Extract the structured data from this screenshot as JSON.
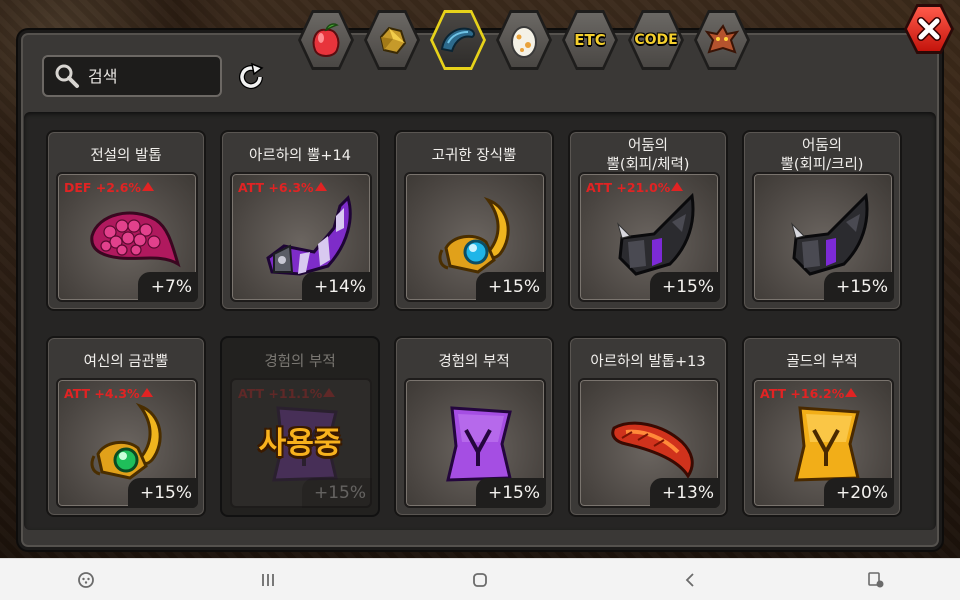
{
  "search": {
    "placeholder": "검색"
  },
  "tabs": [
    {
      "icon": "fruit-icon",
      "label": ""
    },
    {
      "icon": "gold-ore-icon",
      "label": ""
    },
    {
      "icon": "horn-icon",
      "label": "",
      "active": true
    },
    {
      "icon": "egg-icon",
      "label": ""
    },
    {
      "icon": "etc-tab",
      "label": "ETC"
    },
    {
      "icon": "code-tab",
      "label": "CODE"
    },
    {
      "icon": "dragon-icon",
      "label": ""
    }
  ],
  "items": [
    {
      "name": "전설의 발톱",
      "stat": "DEF +2.6%",
      "bonus": "+7%",
      "art": "scale-claw"
    },
    {
      "name": "아르하의 뿔+14",
      "stat": "ATT +6.3%",
      "bonus": "+14%",
      "art": "purple-horn"
    },
    {
      "name": "고귀한 장식뿔",
      "stat": "",
      "bonus": "+15%",
      "art": "gold-horn-blue"
    },
    {
      "name": "어둠의\n뿔(회피/체력)",
      "stat": "ATT +21.0%",
      "bonus": "+15%",
      "art": "dark-horn"
    },
    {
      "name": "어둠의\n뿔(회피/크리)",
      "stat": "",
      "bonus": "+15%",
      "art": "dark-horn"
    },
    {
      "name": "여신의 금관뿔",
      "stat": "ATT +4.3%",
      "bonus": "+15%",
      "art": "gold-horn-green"
    },
    {
      "name": "경험의 부적",
      "stat": "ATT +11.1%",
      "bonus": "+15%",
      "art": "purple-charm",
      "in_use": true,
      "in_use_label": "사용중"
    },
    {
      "name": "경험의 부적",
      "stat": "",
      "bonus": "+15%",
      "art": "purple-charm"
    },
    {
      "name": "아르하의 발톱+13",
      "stat": "",
      "bonus": "+13%",
      "art": "red-claw"
    },
    {
      "name": "골드의 부적",
      "stat": "ATT +16.2%",
      "bonus": "+20%",
      "art": "gold-charm"
    }
  ],
  "colors": {
    "stat_text": "#e12323",
    "in_use_text": "#f8b21d",
    "active_tab_border": "#e7d21a",
    "close_button": "#e0261b"
  },
  "navbar": [
    "game-tools-icon",
    "recent-apps-icon",
    "home-icon",
    "back-icon",
    "screen-mode-icon"
  ]
}
